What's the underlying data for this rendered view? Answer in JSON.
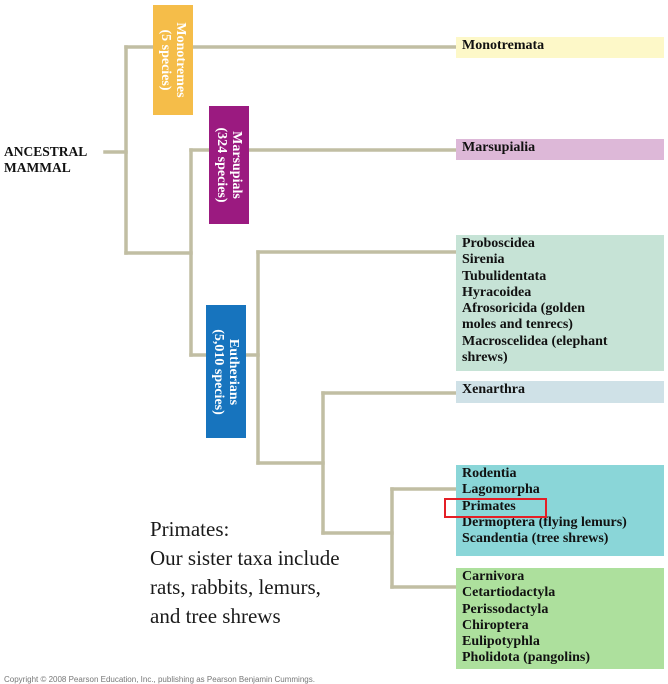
{
  "root_label": [
    "ANCESTRAL",
    "MAMMAL"
  ],
  "clades": [
    {
      "id": "monotremes",
      "lines": [
        "Monotremes",
        "(5 species)"
      ],
      "color": "#f5bd49"
    },
    {
      "id": "marsupials",
      "lines": [
        "Marsupials",
        "(324 species)"
      ],
      "color": "#9b1a80"
    },
    {
      "id": "eutherians",
      "lines": [
        "Eutherians",
        "(5,010 species)"
      ],
      "color": "#1774be"
    }
  ],
  "taxa_groups": [
    {
      "id": "monotremata",
      "color": "#fdf8c8",
      "items": [
        "Monotremata"
      ]
    },
    {
      "id": "marsupialia",
      "color": "#ddb8d8",
      "items": [
        "Marsupialia"
      ]
    },
    {
      "id": "afrotheria",
      "color": "#c6e3d6",
      "items": [
        "Proboscidea",
        "Sirenia",
        "Tubulidentata",
        "Hyracoidea",
        "Afrosoricida (golden",
        "moles and tenrecs)",
        "Macroscelidea (elephant",
        "shrews)"
      ]
    },
    {
      "id": "xenarthra",
      "color": "#cfe1e7",
      "items": [
        "Xenarthra"
      ]
    },
    {
      "id": "euarchontoglires",
      "color": "#8ad6d8",
      "items": [
        "Rodentia",
        "Lagomorpha",
        "Primates",
        "Dermoptera (flying lemurs)",
        "Scandentia (tree shrews)"
      ]
    },
    {
      "id": "laurasiatheria",
      "color": "#ade09d",
      "items": [
        "Carnivora",
        "Cetartiodactyla",
        "Perissodactyla",
        "Chiroptera",
        "Eulipotyphla",
        "Pholidota (pangolins)"
      ]
    }
  ],
  "annotation": [
    "Primates:",
    "Our sister taxa include",
    "rats, rabbits, lemurs,",
    "and tree shrews"
  ],
  "highlight_target": "Primates",
  "copyright": "Copyright © 2008 Pearson Education, Inc., publishing as Pearson Benjamin Cummings.",
  "colors": {
    "branch": "#c1bea3",
    "highlight": "#e41f26"
  }
}
